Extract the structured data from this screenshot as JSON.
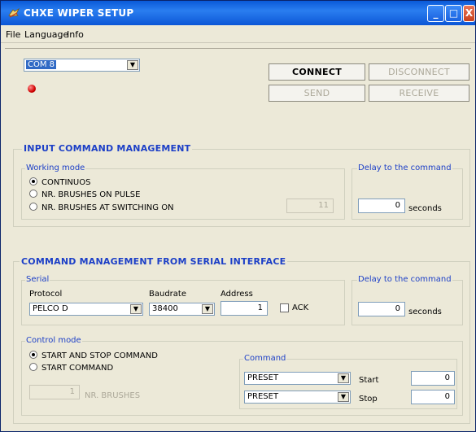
{
  "window": {
    "title": "CHXE WIPER SETUP",
    "controls": {
      "min": "_",
      "max": "□",
      "close": "X"
    }
  },
  "menu": {
    "file": "File",
    "language": "Language",
    "info": "Info"
  },
  "port": {
    "selected": "COM 8"
  },
  "buttons": {
    "connect": "CONNECT",
    "disconnect": "DISCONNECT",
    "send": "SEND",
    "receive": "RECEIVE"
  },
  "input_cmd": {
    "title": "INPUT COMMAND MANAGEMENT",
    "working_mode": {
      "label": "Working mode",
      "options": [
        "CONTINUOS",
        "NR. BRUSHES ON PULSE",
        "NR. BRUSHES AT SWITCHING ON"
      ],
      "selected_index": 0,
      "brushes_value": "11"
    },
    "delay": {
      "label": "Delay to the command",
      "value": "0",
      "unit": "seconds"
    }
  },
  "serial_cmd": {
    "title": "COMMAND MANAGEMENT FROM SERIAL INTERFACE",
    "serial": {
      "label": "Serial",
      "protocol_label": "Protocol",
      "protocol_value": "PELCO D",
      "baudrate_label": "Baudrate",
      "baudrate_value": "38400",
      "address_label": "Address",
      "address_value": "1",
      "ack_label": "ACK",
      "ack_checked": false
    },
    "delay": {
      "label": "Delay to the command",
      "value": "0",
      "unit": "seconds"
    },
    "control_mode": {
      "label": "Control mode",
      "options": [
        "START AND STOP COMMAND",
        "START COMMAND"
      ],
      "selected_index": 0,
      "brushes_value": "1",
      "brushes_label": "NR. BRUSHES"
    },
    "command": {
      "label": "Command",
      "start": {
        "type": "PRESET",
        "label": "Start",
        "value": "0"
      },
      "stop": {
        "type": "PRESET",
        "label": "Stop",
        "value": "0"
      }
    }
  },
  "colors": {
    "accent": "#1c3fc7",
    "titlebar": "#0a5ad8",
    "led": "#d00000"
  }
}
